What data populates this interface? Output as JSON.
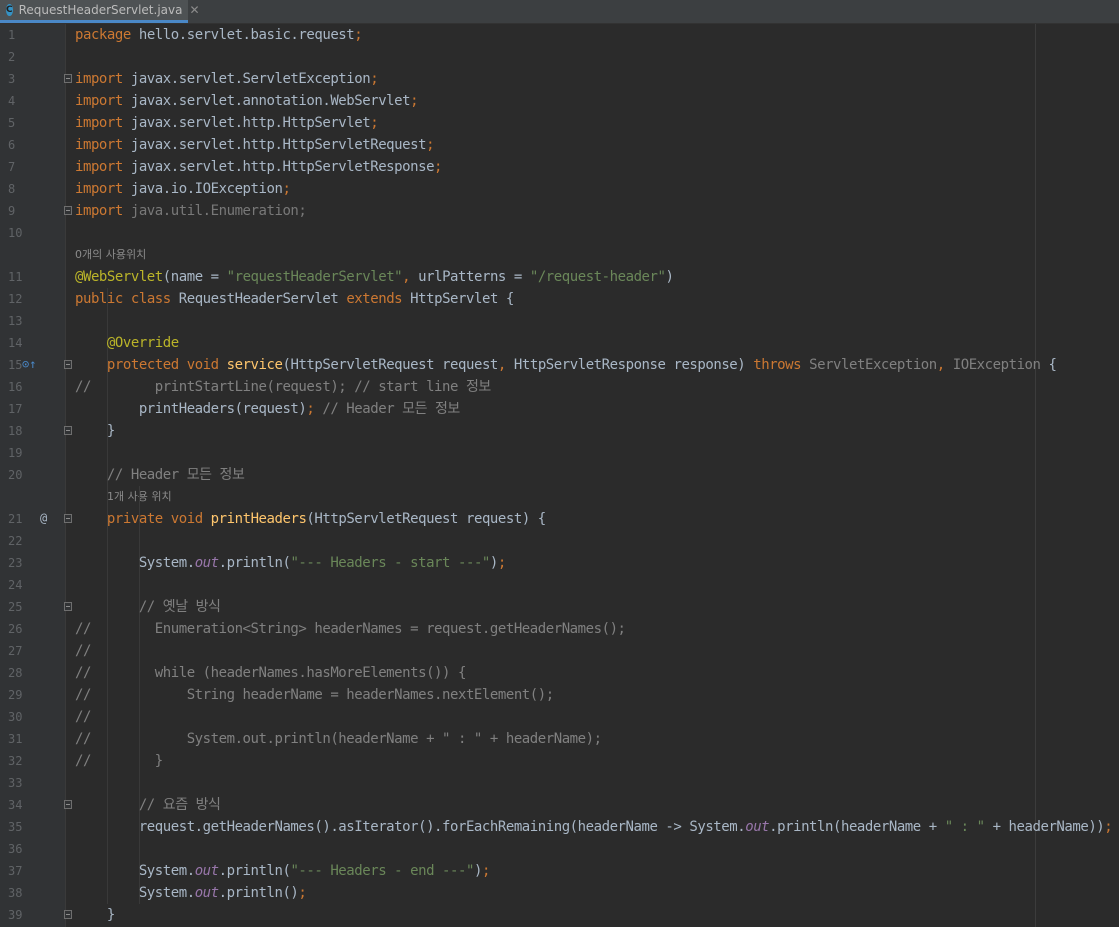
{
  "tab": {
    "icon_letter": "C",
    "label": "RequestHeaderServlet.java",
    "close": "✕"
  },
  "hints": {
    "usage_zero": "0개의 사용위치",
    "usage_one": "1개 사용 위치"
  },
  "lines": [
    "package hello.servlet.basic.request;",
    "",
    "import javax.servlet.ServletException;",
    "import javax.servlet.annotation.WebServlet;",
    "import javax.servlet.http.HttpServlet;",
    "import javax.servlet.http.HttpServletRequest;",
    "import javax.servlet.http.HttpServletResponse;",
    "import java.io.IOException;",
    "import java.util.Enumeration;",
    "",
    "@WebServlet(name = \"requestHeaderServlet\", urlPatterns = \"/request-header\")",
    "public class RequestHeaderServlet extends HttpServlet {",
    "",
    "    @Override",
    "    protected void service(HttpServletRequest request, HttpServletResponse response) throws ServletException, IOException {",
    "//        printStartLine(request); // start line 정보",
    "        printHeaders(request); // Header 모든 정보",
    "    }",
    "",
    "    // Header 모든 정보",
    "    private void printHeaders(HttpServletRequest request) {",
    "",
    "        System.out.println(\"--- Headers - start ---\");",
    "",
    "        // 옛날 방식",
    "//        Enumeration<String> headerNames = request.getHeaderNames();",
    "//",
    "//        while (headerNames.hasMoreElements()) {",
    "//            String headerName = headerNames.nextElement();",
    "//",
    "//            System.out.println(headerName + \" : \" + headerName);",
    "//        }",
    "",
    "        // 요즘 방식",
    "        request.getHeaderNames().asIterator().forEachRemaining(headerName -> System.out.println(headerName + \" : \" + headerName));",
    "",
    "        System.out.println(\"--- Headers - end ---\");",
    "        System.out.println();",
    "    }"
  ],
  "line_numbers": [
    "1",
    "2",
    "3",
    "4",
    "5",
    "6",
    "7",
    "8",
    "9",
    "10",
    "11",
    "12",
    "13",
    "14",
    "15",
    "16",
    "17",
    "18",
    "19",
    "20",
    "21",
    "22",
    "23",
    "24",
    "25",
    "26",
    "27",
    "28",
    "29",
    "30",
    "31",
    "32",
    "33",
    "34",
    "35",
    "36",
    "37",
    "38",
    "39"
  ],
  "gutter_markers": {
    "override": "⊙↑",
    "recursion": "@"
  },
  "colors": {
    "background": "#2b2b2b",
    "keyword": "#cc7832",
    "annotation": "#bbb529",
    "string": "#6a8759",
    "comment": "#808080",
    "static_field": "#9876aa",
    "method_decl": "#ffc66d",
    "text": "#a9b7c6",
    "tab_accent": "#4a88c7"
  }
}
